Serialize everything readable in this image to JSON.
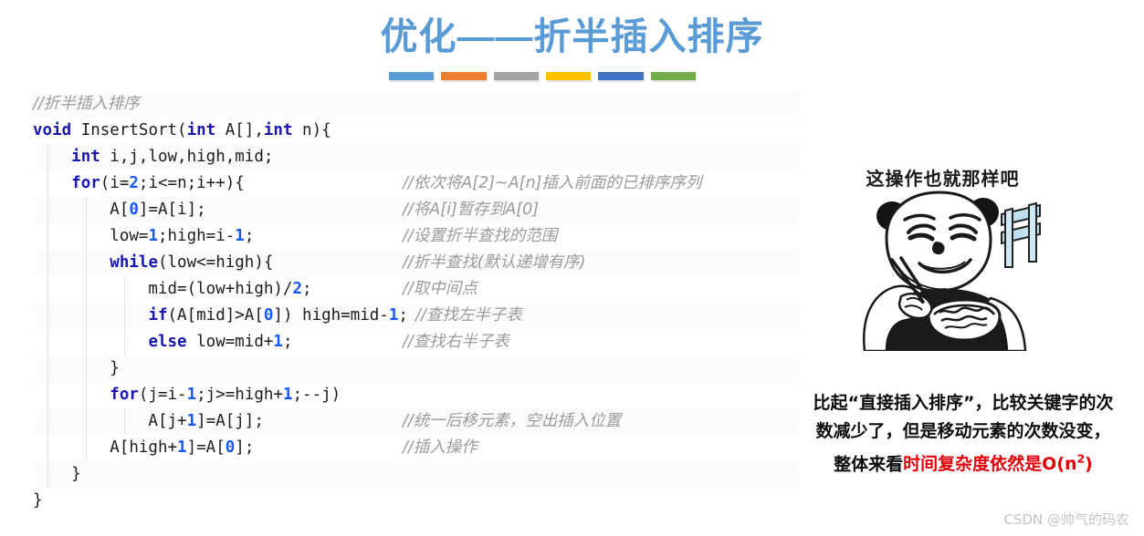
{
  "title": {
    "text": "优化——折半插入排序",
    "color": "#5b9bd5",
    "underline_colors": [
      "#5b9bd5",
      "#ed7d31",
      "#a5a5a5",
      "#ffc000",
      "#4472c4",
      "#70ad47"
    ]
  },
  "code": {
    "language": "c",
    "keyword_color": "#1818b0",
    "number_color": "#1457f5",
    "comment_color": "#9a9a9a",
    "lines": [
      {
        "id": "l1",
        "indent": 0,
        "code": "//折半插入排序",
        "comment": ""
      },
      {
        "id": "l2",
        "indent": 0,
        "code": "void InsertSort(int A[],int n){",
        "comment": ""
      },
      {
        "id": "l3",
        "indent": 1,
        "code": "int i,j,low,high,mid;",
        "comment": ""
      },
      {
        "id": "l4",
        "indent": 1,
        "code": "for(i=2;i<=n;i++){",
        "comment": "//依次将A[2]~A[n]插入前面的已排序序列"
      },
      {
        "id": "l5",
        "indent": 2,
        "code": "A[0]=A[i];",
        "comment": "//将A[i]暂存到A[0]"
      },
      {
        "id": "l6",
        "indent": 2,
        "code": "low=1;high=i-1;",
        "comment": "//设置折半查找的范围"
      },
      {
        "id": "l7",
        "indent": 2,
        "code": "while(low<=high){",
        "comment": "//折半查找(默认递增有序)"
      },
      {
        "id": "l8",
        "indent": 3,
        "code": "mid=(low+high)/2;",
        "comment": "//取中间点"
      },
      {
        "id": "l9",
        "indent": 3,
        "code": "if(A[mid]>A[0]) high=mid-1;",
        "comment": "//查找左半子表"
      },
      {
        "id": "l10",
        "indent": 3,
        "code": "else low=mid+1;",
        "comment": "//查找右半子表"
      },
      {
        "id": "l11",
        "indent": 2,
        "code": "}",
        "comment": ""
      },
      {
        "id": "l12",
        "indent": 2,
        "code": "for(j=i-1;j>=high+1;--j)",
        "comment": ""
      },
      {
        "id": "l13",
        "indent": 3,
        "code": "A[j+1]=A[j];",
        "comment": "//统一后移元素，空出插入位置"
      },
      {
        "id": "l14",
        "indent": 2,
        "code": "A[high+1]=A[0];",
        "comment": "//插入操作"
      },
      {
        "id": "l15",
        "indent": 1,
        "code": "}",
        "comment": ""
      },
      {
        "id": "l16",
        "indent": 0,
        "code": "}",
        "comment": ""
      }
    ]
  },
  "meme": {
    "caption": "这操作也就那样吧",
    "alt": "panda-man-eating-noodles-meme"
  },
  "note": {
    "line1": "比起“直接插入排序”，比较关键字的次",
    "line2": "数减少了，但是移动元素的次数没变，",
    "line3_prefix": "整体来看",
    "line3_highlight": "时间复杂度依然是O(n",
    "line3_sup": "2",
    "line3_suffix": ")",
    "highlight_color": "#e3000b"
  },
  "watermark": {
    "text": "CSDN @帅气的码农"
  }
}
